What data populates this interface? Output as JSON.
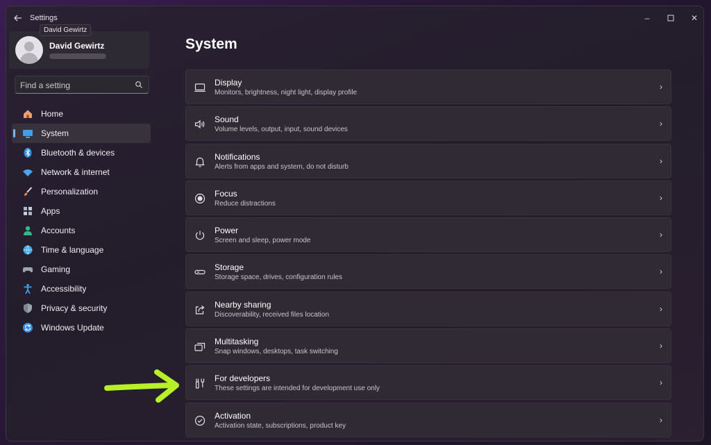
{
  "window": {
    "title": "Settings",
    "tooltip": "David Gewirtz",
    "controls": {
      "minimize": "–",
      "maximize": "☐",
      "close": "✕"
    }
  },
  "profile": {
    "name": "David Gewirtz"
  },
  "search": {
    "placeholder": "Find a setting",
    "icon": "search-icon"
  },
  "nav": {
    "items": [
      {
        "label": "Home",
        "icon": "home-icon",
        "color": "#f0a070"
      },
      {
        "label": "System",
        "icon": "system-icon",
        "color": "#3f9fe8",
        "active": true
      },
      {
        "label": "Bluetooth & devices",
        "icon": "bluetooth-icon",
        "color": "#2d8fe0"
      },
      {
        "label": "Network & internet",
        "icon": "network-icon",
        "color": "#4aa6ee"
      },
      {
        "label": "Personalization",
        "icon": "brush-icon",
        "color": "#e88a4a"
      },
      {
        "label": "Apps",
        "icon": "apps-icon",
        "color": "#a9b6c8"
      },
      {
        "label": "Accounts",
        "icon": "accounts-icon",
        "color": "#2fb98a"
      },
      {
        "label": "Time & language",
        "icon": "globe-icon",
        "color": "#3fa3e6"
      },
      {
        "label": "Gaming",
        "icon": "gaming-icon",
        "color": "#9aa3ad"
      },
      {
        "label": "Accessibility",
        "icon": "accessibility-icon",
        "color": "#3ea0f0"
      },
      {
        "label": "Privacy & security",
        "icon": "shield-icon",
        "color": "#9aa3ad"
      },
      {
        "label": "Windows Update",
        "icon": "update-icon",
        "color": "#2f8ee6"
      }
    ]
  },
  "main": {
    "title": "System",
    "cards": [
      {
        "title": "Display",
        "subtitle": "Monitors, brightness, night light, display profile",
        "icon": "display-icon"
      },
      {
        "title": "Sound",
        "subtitle": "Volume levels, output, input, sound devices",
        "icon": "speaker-icon"
      },
      {
        "title": "Notifications",
        "subtitle": "Alerts from apps and system, do not disturb",
        "icon": "bell-icon"
      },
      {
        "title": "Focus",
        "subtitle": "Reduce distractions",
        "icon": "focus-icon"
      },
      {
        "title": "Power",
        "subtitle": "Screen and sleep, power mode",
        "icon": "power-icon"
      },
      {
        "title": "Storage",
        "subtitle": "Storage space, drives, configuration rules",
        "icon": "storage-icon"
      },
      {
        "title": "Nearby sharing",
        "subtitle": "Discoverability, received files location",
        "icon": "share-icon"
      },
      {
        "title": "Multitasking",
        "subtitle": "Snap windows, desktops, task switching",
        "icon": "multitask-icon"
      },
      {
        "title": "For developers",
        "subtitle": "These settings are intended for development use only",
        "icon": "developer-tools-icon"
      },
      {
        "title": "Activation",
        "subtitle": "Activation state, subscriptions, product key",
        "icon": "check-circle-icon"
      }
    ],
    "chevron": "›"
  },
  "annotation": {
    "arrow_color": "#b8f028",
    "icon": "arrow-right-icon"
  }
}
